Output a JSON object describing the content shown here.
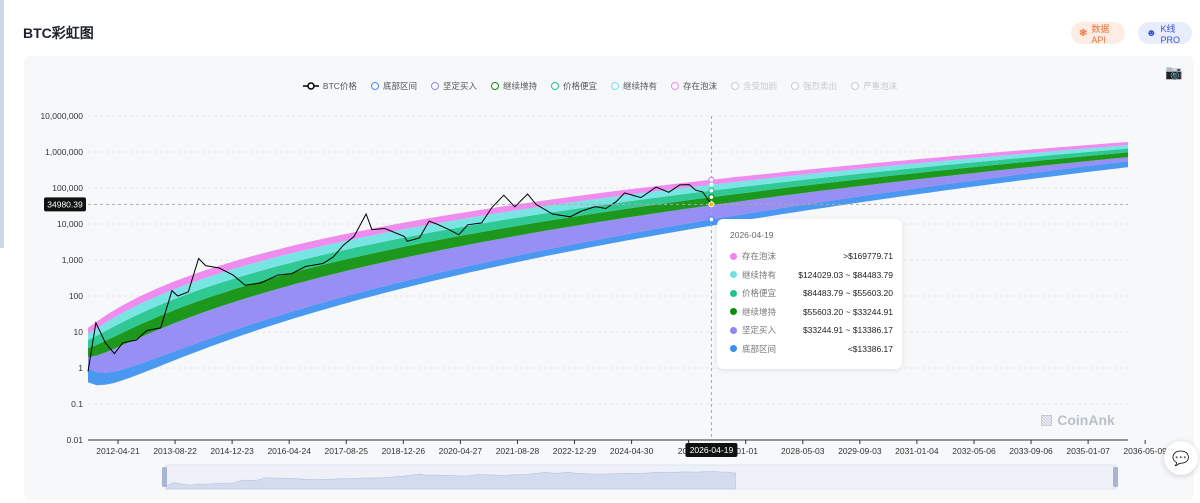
{
  "header": {
    "title": "BTC彩虹图",
    "api_button": "数据API",
    "pro_button": "K线 PRO"
  },
  "legend": [
    {
      "label": "BTC价格",
      "color": "#000000",
      "active": true,
      "kind": "line"
    },
    {
      "label": "底部区间",
      "color": "#3b8ff0",
      "active": true
    },
    {
      "label": "坚定买入",
      "color": "#8e86f2",
      "active": true
    },
    {
      "label": "继续增持",
      "color": "#0a8f0a",
      "active": true
    },
    {
      "label": "价格便宜",
      "color": "#1ec48a",
      "active": true
    },
    {
      "label": "继续持有",
      "color": "#6ee2e2",
      "active": true
    },
    {
      "label": "存在泡沫",
      "color": "#ee82ee",
      "active": true
    },
    {
      "label": "含受加剧",
      "color": "#c7cad0",
      "active": false
    },
    {
      "label": "强烈卖出",
      "color": "#c7cad0",
      "active": false
    },
    {
      "label": "严重泡沫",
      "color": "#c7cad0",
      "active": false
    }
  ],
  "tooltip": {
    "date": "2026-04-19",
    "rows": [
      {
        "name": "存在泡沫",
        "value": ">$169779.71",
        "color": "#ee82ee"
      },
      {
        "name": "继续持有",
        "value": "$124029.03 ~ $84483.79",
        "color": "#6ee2e2"
      },
      {
        "name": "价格便宜",
        "value": "$84483.79 ~ $55603.20",
        "color": "#1ec48a"
      },
      {
        "name": "继续增持",
        "value": "$55603.20 ~ $33244.91",
        "color": "#0a8f0a"
      },
      {
        "name": "坚定买入",
        "value": "$33244.91 ~ $13386.17",
        "color": "#8e86f2"
      },
      {
        "name": "底部区间",
        "value": "<$13386.17",
        "color": "#3b8ff0"
      }
    ]
  },
  "watermark": "CoinAnk",
  "chart_data": {
    "type": "area",
    "y_scale": "log",
    "ylim": [
      0.01,
      10000000
    ],
    "y_ticks": [
      "10,000,000",
      "1,000,000",
      "100,000",
      "10,000",
      "1,000",
      "100",
      "10",
      "1",
      "0.1",
      "0.01"
    ],
    "x_range": [
      "2011-04-01",
      "2036-05-09"
    ],
    "x_ticks": [
      "2012-04-21",
      "2013-08-22",
      "2014-12-23",
      "2016-04-24",
      "2017-08-25",
      "2018-12-26",
      "2020-04-27",
      "2021-08-28",
      "2022-12-29",
      "2024-04-30",
      "2025-",
      "-01-01",
      "2028-05-03",
      "2029-09-03",
      "2031-01-04",
      "2032-05-06",
      "2033-09-06",
      "2035-01-07",
      "2036-05-09"
    ],
    "crosshair": {
      "x_label": "2026-04-19",
      "y_label": "34980.39",
      "y_value": 34980.39
    },
    "bands": [
      {
        "name": "底部区间",
        "color": "#3b8ff0",
        "values_at_dates": [
          {
            "date": "2011-04-01",
            "low": 0.4,
            "high": 1.0
          },
          {
            "date": "2026-04-19",
            "low": 9000,
            "high": 13386.17
          },
          {
            "date": "2036-05-09",
            "low": 380000,
            "high": 560000
          }
        ]
      },
      {
        "name": "坚定买入",
        "color": "#8e86f2",
        "values_at_dates": [
          {
            "date": "2011-04-01",
            "low": 1.0,
            "high": 2.0
          },
          {
            "date": "2026-04-19",
            "low": 13386.17,
            "high": 33244.91
          },
          {
            "date": "2036-05-09",
            "low": 560000,
            "high": 720000
          }
        ]
      },
      {
        "name": "继续增持",
        "color": "#0a8f0a",
        "values_at_dates": [
          {
            "date": "2011-04-01",
            "low": 2.0,
            "high": 3.6
          },
          {
            "date": "2026-04-19",
            "low": 33244.91,
            "high": 55603.2
          },
          {
            "date": "2036-05-09",
            "low": 720000,
            "high": 980000
          }
        ]
      },
      {
        "name": "价格便宜",
        "color": "#1ec48a",
        "values_at_dates": [
          {
            "date": "2011-04-01",
            "low": 3.6,
            "high": 6.0
          },
          {
            "date": "2026-04-19",
            "low": 55603.2,
            "high": 84483.79
          },
          {
            "date": "2036-05-09",
            "low": 980000,
            "high": 1250000
          }
        ]
      },
      {
        "name": "继续持有",
        "color": "#6ee2e2",
        "values_at_dates": [
          {
            "date": "2011-04-01",
            "low": 6.0,
            "high": 9.0
          },
          {
            "date": "2026-04-19",
            "low": 84483.79,
            "high": 124029.03
          },
          {
            "date": "2036-05-09",
            "low": 1250000,
            "high": 1550000
          }
        ]
      },
      {
        "name": "存在泡沫",
        "color": "#ee82ee",
        "values_at_dates": [
          {
            "date": "2011-04-01",
            "low": 9.0,
            "high": 13.0
          },
          {
            "date": "2026-04-19",
            "low": 124029.03,
            "high": 169779.71
          },
          {
            "date": "2036-05-09",
            "low": 1550000,
            "high": 1900000
          }
        ]
      }
    ],
    "series": [
      {
        "name": "BTC价格",
        "color": "#000000",
        "points": [
          [
            "2011-04-01",
            0.8
          ],
          [
            "2011-06-10",
            18
          ],
          [
            "2011-09-01",
            5
          ],
          [
            "2011-11-20",
            2.5
          ],
          [
            "2012-02-01",
            5
          ],
          [
            "2012-06-01",
            6
          ],
          [
            "2012-09-01",
            11
          ],
          [
            "2013-01-01",
            13
          ],
          [
            "2013-04-10",
            140
          ],
          [
            "2013-06-01",
            100
          ],
          [
            "2013-09-01",
            130
          ],
          [
            "2013-12-01",
            1100
          ],
          [
            "2014-02-01",
            700
          ],
          [
            "2014-06-01",
            600
          ],
          [
            "2014-10-01",
            380
          ],
          [
            "2015-01-15",
            200
          ],
          [
            "2015-06-01",
            230
          ],
          [
            "2015-11-01",
            380
          ],
          [
            "2016-03-01",
            420
          ],
          [
            "2016-07-01",
            660
          ],
          [
            "2016-12-01",
            800
          ],
          [
            "2017-03-01",
            1200
          ],
          [
            "2017-06-01",
            2600
          ],
          [
            "2017-09-01",
            4500
          ],
          [
            "2017-12-17",
            19000
          ],
          [
            "2018-02-06",
            7000
          ],
          [
            "2018-06-01",
            7500
          ],
          [
            "2018-11-20",
            4500
          ],
          [
            "2018-12-15",
            3300
          ],
          [
            "2019-04-01",
            4100
          ],
          [
            "2019-06-26",
            12000
          ],
          [
            "2019-09-01",
            10000
          ],
          [
            "2019-12-15",
            7100
          ],
          [
            "2020-03-13",
            5000
          ],
          [
            "2020-06-01",
            9500
          ],
          [
            "2020-10-01",
            10700
          ],
          [
            "2020-12-31",
            29000
          ],
          [
            "2021-04-14",
            63000
          ],
          [
            "2021-07-20",
            30000
          ],
          [
            "2021-11-10",
            68000
          ],
          [
            "2022-01-24",
            35000
          ],
          [
            "2022-06-18",
            19000
          ],
          [
            "2022-11-21",
            15800
          ],
          [
            "2023-03-01",
            23000
          ],
          [
            "2023-07-01",
            30500
          ],
          [
            "2023-10-01",
            27000
          ],
          [
            "2024-01-01",
            42000
          ],
          [
            "2024-03-14",
            73000
          ],
          [
            "2024-08-05",
            54000
          ],
          [
            "2024-12-17",
            106000
          ],
          [
            "2025-04-07",
            76000
          ],
          [
            "2025-07-14",
            122000
          ],
          [
            "2025-10-06",
            124000
          ],
          [
            "2025-12-01",
            87000
          ],
          [
            "2026-02-01",
            78000
          ],
          [
            "2026-04-19",
            34980.39
          ]
        ]
      }
    ]
  }
}
